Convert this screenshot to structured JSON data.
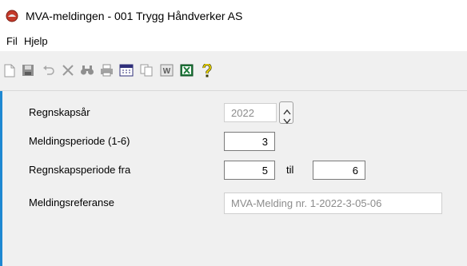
{
  "window": {
    "title": "MVA-meldingen - 001 Trygg Håndverker AS"
  },
  "menu": {
    "items": [
      "Fil",
      "Hjelp"
    ]
  },
  "toolbar": {
    "icons": [
      "new-document-icon",
      "save-icon",
      "undo-icon",
      "delete-icon",
      "find-icon",
      "print-icon",
      "calendar-icon",
      "copy-icon",
      "word-icon",
      "excel-icon",
      "help-icon"
    ]
  },
  "form": {
    "fiscal_year": {
      "label": "Regnskapsår",
      "value": "2022"
    },
    "reporting_period": {
      "label": "Meldingsperiode (1-6)",
      "value": "3"
    },
    "accounting_period": {
      "label": "Regnskapsperiode fra",
      "from": "5",
      "to_label": "til",
      "to": "6"
    },
    "reference": {
      "label": "Meldingsreferanse",
      "value": "MVA-Melding nr. 1-2022-3-05-06"
    }
  },
  "colors": {
    "background_blue": "#1f83cd",
    "excel_green": "#1e7a3a",
    "help_yellow": "#e8c800"
  }
}
